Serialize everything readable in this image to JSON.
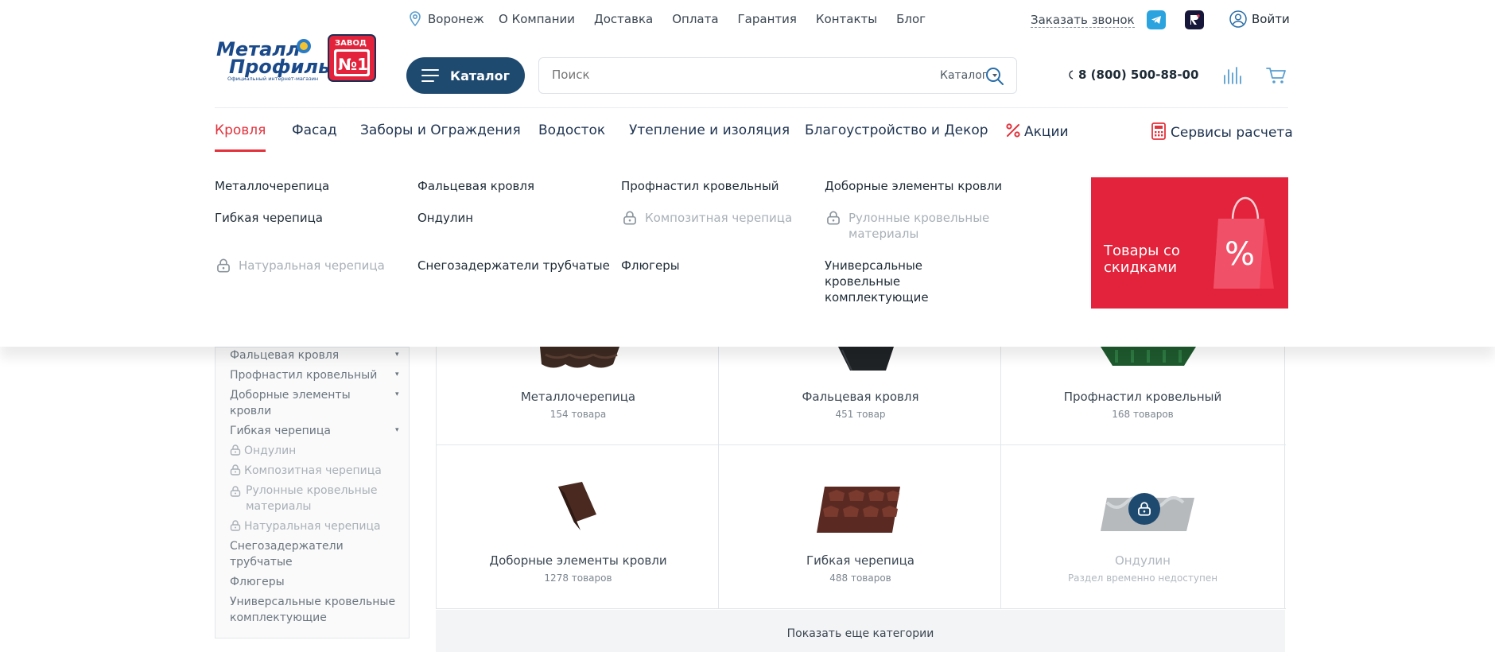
{
  "header": {
    "city": "Воронеж",
    "nav": [
      "О Компании",
      "Доставка",
      "Оплата",
      "Гарантия",
      "Контакты",
      "Блог"
    ],
    "callback": "Заказать звонок",
    "login": "Войти",
    "logo": {
      "line1": "Металл",
      "line2": "Профиль",
      "tagline": "Официальный интернет-магазин",
      "badge_top": "ЗАВОД",
      "badge_num": "№1"
    }
  },
  "catalog_button": "Каталог",
  "search": {
    "placeholder": "Поиск",
    "scope": "Каталог"
  },
  "phone": "8 (800) 500-88-00",
  "categories": [
    {
      "label": "Кровля",
      "active": true
    },
    {
      "label": "Фасад"
    },
    {
      "label": "Заборы и Ограждения"
    },
    {
      "label": "Водосток"
    },
    {
      "label": "Утепление и изоляция"
    },
    {
      "label": "Благоустройство и Декор"
    },
    {
      "label": "Акции"
    }
  ],
  "services": "Сервисы расчета",
  "mega_menu": {
    "links": [
      {
        "label": "Металлочерепица"
      },
      {
        "label": "Фальцевая кровля"
      },
      {
        "label": "Профнастил кровельный"
      },
      {
        "label": "Доборные элементы кровли"
      },
      {
        "label": "Гибкая черепица"
      },
      {
        "label": "Ондулин"
      },
      {
        "label": "Композитная черепица",
        "locked": true
      },
      {
        "label": "Рулонные кровельные материалы",
        "locked": true
      },
      {
        "label": "Натуральная черепица",
        "locked": true
      },
      {
        "label": "Снегозадержатели трубчатые"
      },
      {
        "label": "Флюгеры"
      },
      {
        "label": "Универсальные кровельные комплектующие"
      }
    ],
    "promo": "Товары со скидками"
  },
  "sidebar": {
    "items": [
      {
        "label": "Фальцевая кровля",
        "caret": true
      },
      {
        "label": "Профнастил кровельный",
        "caret": true
      },
      {
        "label": "Доборные элементы кровли",
        "caret": true
      },
      {
        "label": "Гибкая черепица",
        "caret": true
      },
      {
        "label": "Ондулин",
        "locked": true
      },
      {
        "label": "Композитная черепица",
        "locked": true
      },
      {
        "label": "Рулонные кровельные материалы",
        "locked": true
      },
      {
        "label": "Натуральная черепица",
        "locked": true
      },
      {
        "label": "Снегозадержатели трубчатые"
      },
      {
        "label": "Флюгеры"
      },
      {
        "label": "Универсальные кровельные комплектующие"
      }
    ]
  },
  "grid": [
    {
      "name": "Металлочерепица",
      "count": "154 товара"
    },
    {
      "name": "Фальцевая кровля",
      "count": "451 товар"
    },
    {
      "name": "Профнастил кровельный",
      "count": "168 товаров"
    },
    {
      "name": "Доборные элементы кровли",
      "count": "1278 товаров"
    },
    {
      "name": "Гибкая черепица",
      "count": "488 товаров"
    },
    {
      "name": "Ондулин",
      "count": "Раздел временно недоступен",
      "locked": true
    }
  ],
  "more_button": "Показать еще категории",
  "colors": {
    "accent": "#e2323c",
    "primary": "#1f4a70",
    "promo": "#e2233b"
  }
}
